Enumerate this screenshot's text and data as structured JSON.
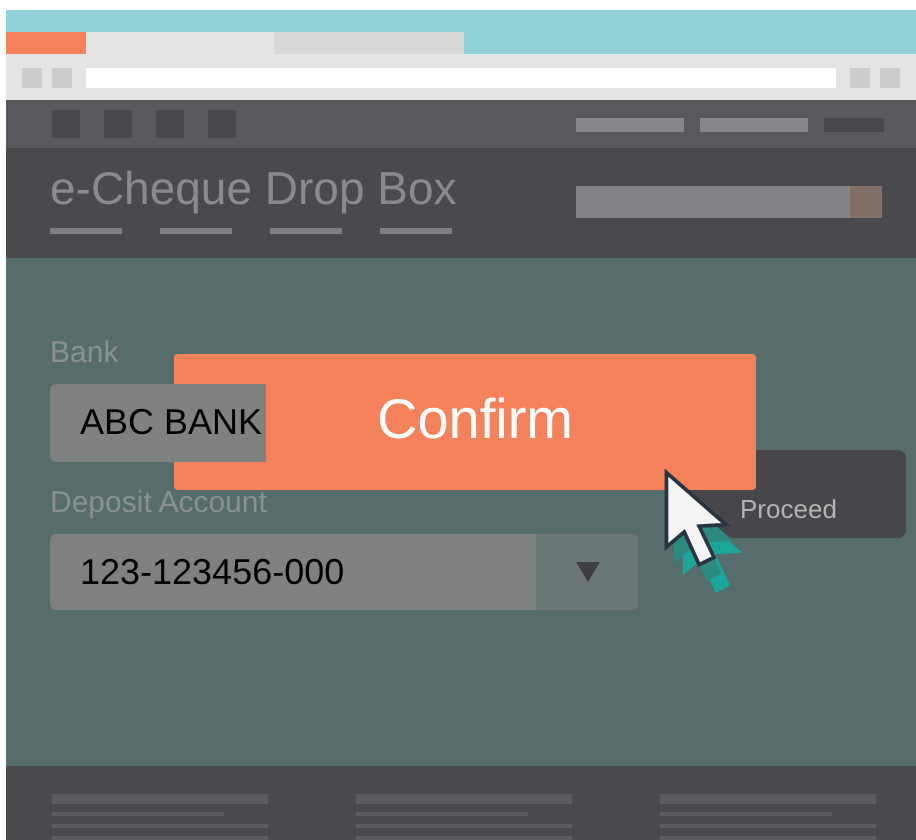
{
  "header": {
    "title": "e-Cheque Drop Box"
  },
  "form": {
    "fields": [
      {
        "kind": "text",
        "label": "Bank",
        "value": "ABC BANK"
      },
      {
        "kind": "select",
        "label": "Deposit Account",
        "value": "123-123456-000"
      }
    ]
  },
  "buttons": [
    {
      "kind": "primary",
      "label": "Confirm"
    },
    {
      "kind": "secondary",
      "label": "Proceed"
    }
  ]
}
